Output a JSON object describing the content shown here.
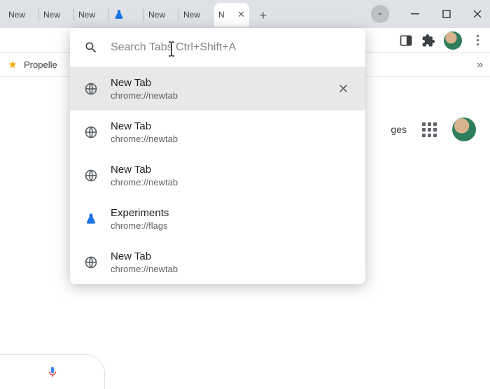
{
  "tabs": [
    {
      "label": "New"
    },
    {
      "label": "New"
    },
    {
      "label": "New"
    },
    {
      "label": "",
      "icon": "flask"
    },
    {
      "label": "New"
    },
    {
      "label": "New"
    },
    {
      "label": "N",
      "active": true
    }
  ],
  "window": {
    "dropdown": true
  },
  "toolbar": {},
  "bookmarks": {
    "items": [
      {
        "label": "Propelle"
      }
    ]
  },
  "content": {
    "right_label": "ges"
  },
  "tabsearch": {
    "placeholder": "Search Tabs Ctrl+Shift+A",
    "items": [
      {
        "title": "New Tab",
        "url": "chrome://newtab",
        "icon": "globe",
        "highlight": true,
        "closable": true
      },
      {
        "title": "New Tab",
        "url": "chrome://newtab",
        "icon": "globe"
      },
      {
        "title": "New Tab",
        "url": "chrome://newtab",
        "icon": "globe"
      },
      {
        "title": "Experiments",
        "url": "chrome://flags",
        "icon": "flask"
      },
      {
        "title": "New Tab",
        "url": "chrome://newtab",
        "icon": "globe"
      }
    ]
  }
}
